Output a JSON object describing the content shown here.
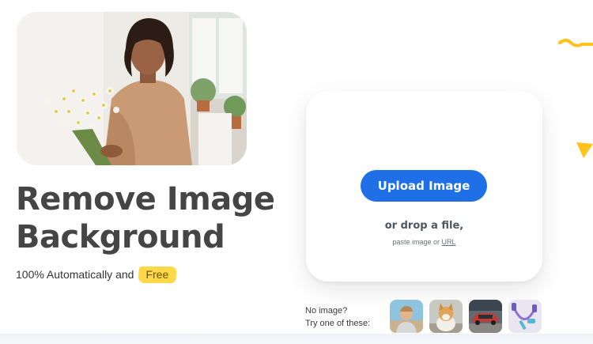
{
  "hero": {
    "title_line1": "Remove Image",
    "title_line2": "Background",
    "subtitle": "100% Automatically and",
    "free_badge": "Free"
  },
  "upload": {
    "button_label": "Upload Image",
    "drop_text": "or drop a file,",
    "paste_prefix": "paste image or",
    "url_link": "URL"
  },
  "samples": {
    "label_line1": "No image?",
    "label_line2": "Try one of these:",
    "items": [
      "man-portrait",
      "corgi-dog",
      "red-car",
      "jump-rope-and-dumbbells"
    ]
  },
  "colors": {
    "accent_blue": "#1f6fe6",
    "accent_yellow": "#ffd84a",
    "headline_gray": "#454545"
  }
}
